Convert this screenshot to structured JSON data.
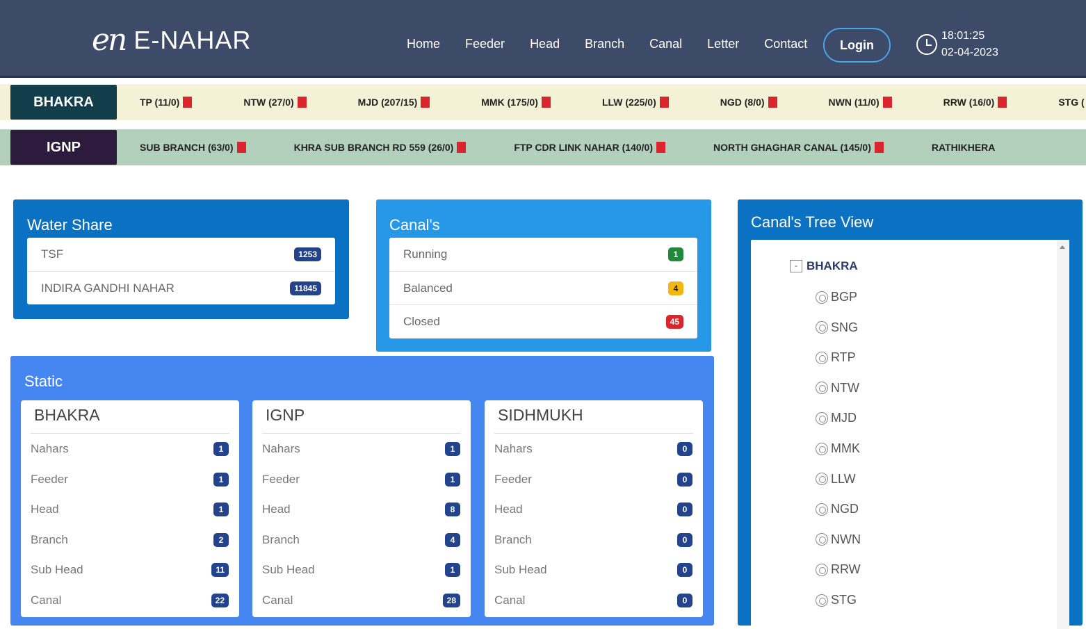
{
  "brand": {
    "mark": "en",
    "name": "E-NAHAR"
  },
  "nav": [
    "Home",
    "Feeder",
    "Head",
    "Branch",
    "Canal",
    "Letter",
    "Contact"
  ],
  "login_label": "Login",
  "clock": {
    "time": "18:01:25",
    "date": "02-04-2023"
  },
  "tickers": {
    "bhakra": {
      "label": "BHAKRA",
      "items": [
        "TP (11/0)",
        "NTW (27/0)",
        "MJD (207/15)",
        "MMK (175/0)",
        "LLW (225/0)",
        "NGD (8/0)",
        "NWN (11/0)",
        "RRW (16/0)",
        "STG ("
      ]
    },
    "ignp": {
      "label": "IGNP",
      "items": [
        "SUB BRANCH (63/0)",
        "KHRA SUB BRANCH RD 559 (26/0)",
        "FTP CDR LINK NAHAR (140/0)",
        "NORTH GHAGHAR CANAL (145/0)",
        "RATHIKHERA"
      ]
    }
  },
  "water_share": {
    "title": "Water Share",
    "rows": [
      {
        "label": "TSF",
        "value": "1253"
      },
      {
        "label": "INDIRA GANDHI NAHAR",
        "value": "11845"
      }
    ]
  },
  "canals": {
    "title": "Canal's",
    "rows": [
      {
        "label": "Running",
        "value": "1",
        "color": "#1e8a3a"
      },
      {
        "label": "Balanced",
        "value": "4",
        "color": "#f2b60f"
      },
      {
        "label": "Closed",
        "value": "45",
        "color": "#d9252b"
      }
    ]
  },
  "tree": {
    "title": "Canal's Tree View",
    "toggle": "-",
    "root": "BHAKRA",
    "children": [
      "BGP",
      "SNG",
      "RTP",
      "NTW",
      "MJD",
      "MMK",
      "LLW",
      "NGD",
      "NWN",
      "RRW",
      "STG"
    ]
  },
  "static": {
    "title": "Static",
    "cards": [
      {
        "title": "BHAKRA",
        "rows": [
          {
            "label": "Nahars",
            "value": "1"
          },
          {
            "label": "Feeder",
            "value": "1"
          },
          {
            "label": "Head",
            "value": "1"
          },
          {
            "label": "Branch",
            "value": "2"
          },
          {
            "label": "Sub Head",
            "value": "11"
          },
          {
            "label": "Canal",
            "value": "22"
          }
        ]
      },
      {
        "title": "IGNP",
        "rows": [
          {
            "label": "Nahars",
            "value": "1"
          },
          {
            "label": "Feeder",
            "value": "1"
          },
          {
            "label": "Head",
            "value": "8"
          },
          {
            "label": "Branch",
            "value": "4"
          },
          {
            "label": "Sub Head",
            "value": "1"
          },
          {
            "label": "Canal",
            "value": "28"
          }
        ]
      },
      {
        "title": "SIDHMUKH",
        "rows": [
          {
            "label": "Nahars",
            "value": "0"
          },
          {
            "label": "Feeder",
            "value": "0"
          },
          {
            "label": "Head",
            "value": "0"
          },
          {
            "label": "Branch",
            "value": "0"
          },
          {
            "label": "Sub Head",
            "value": "0"
          },
          {
            "label": "Canal",
            "value": "0"
          }
        ]
      }
    ]
  }
}
